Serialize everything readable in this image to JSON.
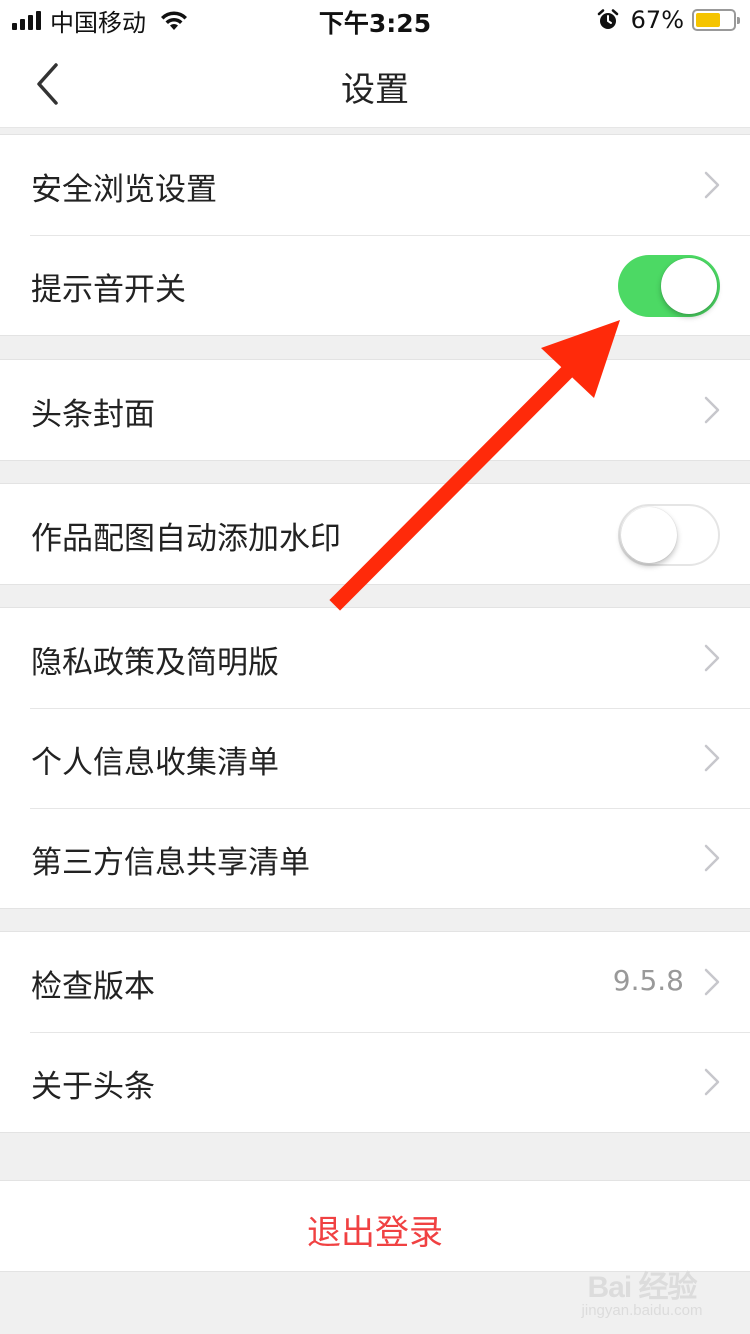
{
  "status_bar": {
    "carrier": "中国移动",
    "time": "下午3:25",
    "battery_percent": "67%",
    "battery_level": 0.67,
    "battery_color": "#f5c400"
  },
  "nav": {
    "title": "设置",
    "back_icon": "chevron-left-icon"
  },
  "settings": {
    "safe_browsing": {
      "label": "安全浏览设置"
    },
    "sound_toggle": {
      "label": "提示音开关",
      "checked": true
    },
    "headline_cover": {
      "label": "头条封面"
    },
    "watermark_toggle": {
      "label": "作品配图自动添加水印",
      "checked": false
    },
    "privacy_policy": {
      "label": "隐私政策及简明版"
    },
    "personal_info_list": {
      "label": "个人信息收集清单"
    },
    "third_party_list": {
      "label": "第三方信息共享清单"
    },
    "check_version": {
      "label": "检查版本",
      "value": "9.5.8"
    },
    "about": {
      "label": "关于头条"
    }
  },
  "logout": {
    "label": "退出登录",
    "color": "#f04142"
  },
  "colors": {
    "toggle_on": "#4cd964",
    "annotation_arrow": "#ff2a0a"
  },
  "watermark": {
    "logo": "Bai 经验",
    "sub": "jingyan.baidu.com"
  }
}
